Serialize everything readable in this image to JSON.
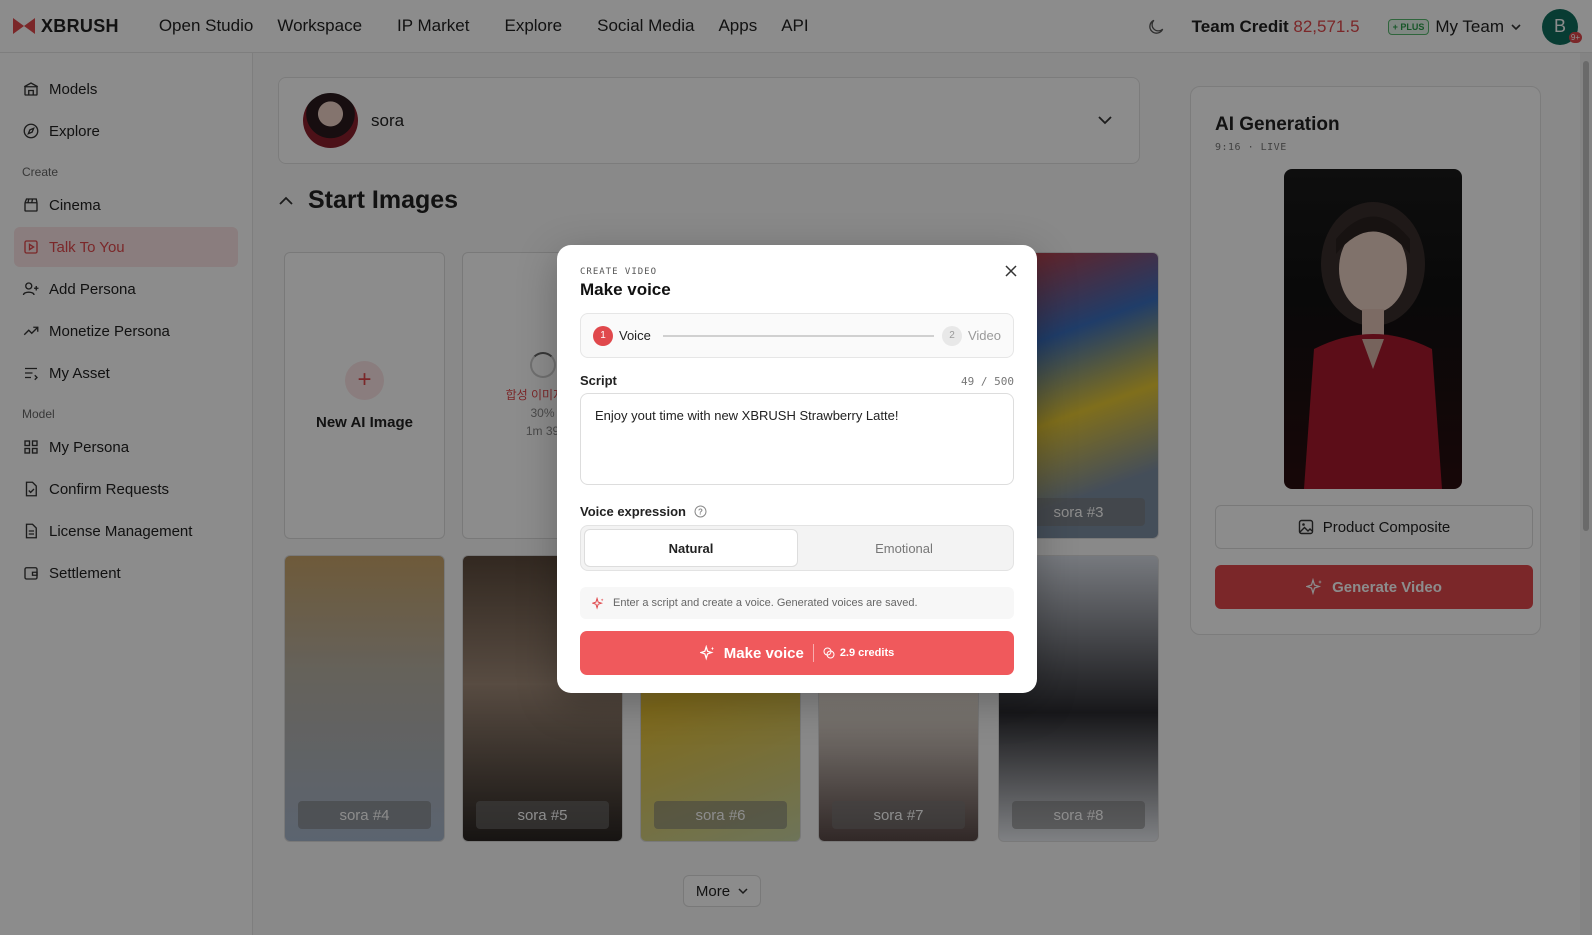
{
  "app": {
    "brand": "XBRUSH"
  },
  "nav": [
    "Open Studio",
    "Workspace",
    "IP Market",
    "Explore",
    "Social Media",
    "Apps",
    "API"
  ],
  "header": {
    "credit_label": "Team Credit",
    "credit_value": "82,571.5",
    "plan_badge": "+ PLUS",
    "team_name": "My Team",
    "avatar_initial": "B",
    "avatar_badge": "9+"
  },
  "sidebar": {
    "top_items": [
      {
        "label": "Models",
        "icon": "building-icon"
      },
      {
        "label": "Explore",
        "icon": "compass-icon"
      }
    ],
    "create_section": "Create",
    "create_items": [
      {
        "label": "Cinema",
        "icon": "clapper-icon"
      },
      {
        "label": "Talk To You",
        "icon": "play-square-icon",
        "active": true
      },
      {
        "label": "Add Persona",
        "icon": "user-plus-icon"
      },
      {
        "label": "Monetize Persona",
        "icon": "trend-icon"
      },
      {
        "label": "My Asset",
        "icon": "list-icon"
      }
    ],
    "model_section": "Model",
    "model_items": [
      {
        "label": "My Persona",
        "icon": "grid-icon"
      },
      {
        "label": "Confirm Requests",
        "icon": "file-check-icon"
      },
      {
        "label": "License Management",
        "icon": "file-text-icon"
      },
      {
        "label": "Settlement",
        "icon": "wallet-icon"
      }
    ]
  },
  "main": {
    "persona_name": "sora",
    "section_title": "Start Images",
    "new_card_label": "New AI Image",
    "loading": {
      "status": "합성 이미지 …",
      "percent": "30%",
      "eta": "1m 39"
    },
    "cards": [
      "sora #3",
      "sora #4",
      "sora #5",
      "sora #6",
      "sora #7",
      "sora #8"
    ],
    "more_label": "More"
  },
  "right_panel": {
    "title": "AI Generation",
    "subtitle": "9:16 · LIVE",
    "composite_label": "Product Composite",
    "generate_label": "Generate Video"
  },
  "modal": {
    "kicker": "CREATE VIDEO",
    "title": "Make voice",
    "steps": [
      {
        "num": "1",
        "label": "Voice"
      },
      {
        "num": "2",
        "label": "Video"
      }
    ],
    "script_label": "Script",
    "script_count": "49 / 500",
    "script_value": "Enjoy yout time with new XBRUSH Strawberry Latte!",
    "voice_expression_label": "Voice expression",
    "options": [
      "Natural",
      "Emotional"
    ],
    "hint": "Enter a script and create a voice. Generated voices are saved.",
    "make_label": "Make voice",
    "credits": "2.9 credits"
  },
  "colors": {
    "accent": "#e0484c",
    "button": "#f0595c"
  }
}
